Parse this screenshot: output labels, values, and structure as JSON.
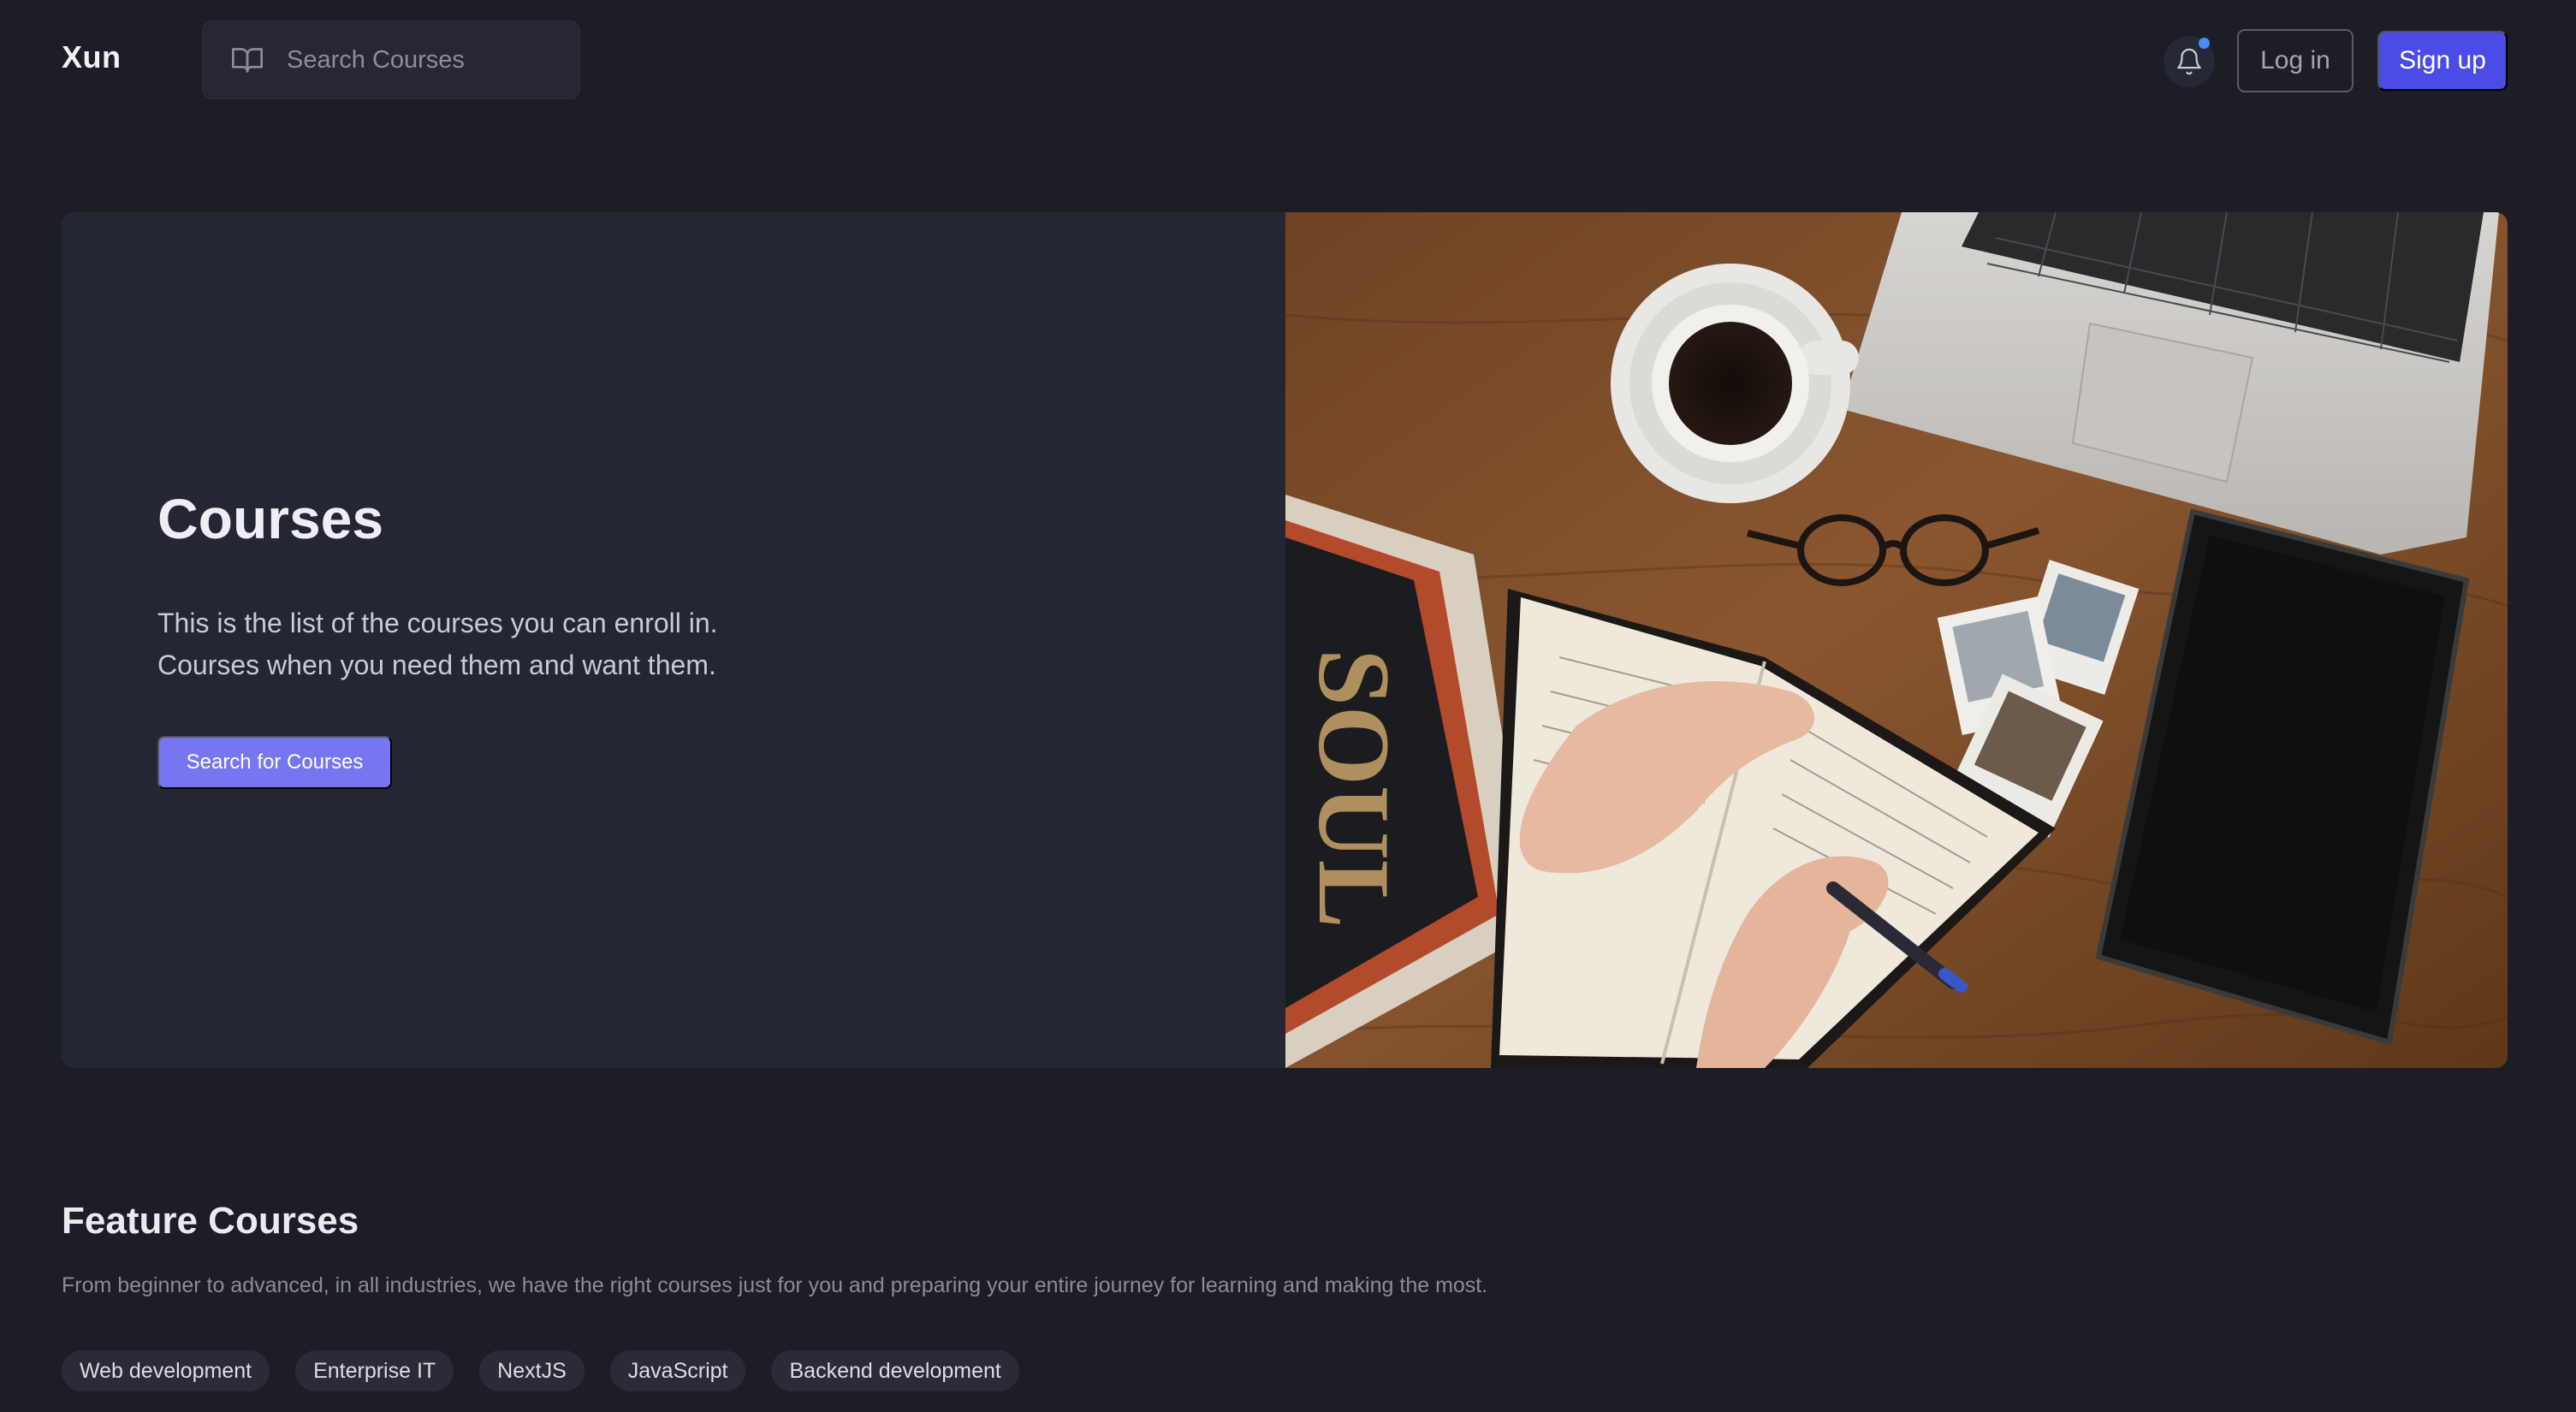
{
  "header": {
    "logo": "Xun",
    "search": {
      "placeholder": "Search Courses",
      "icon": "book-open-icon"
    },
    "notification": {
      "icon": "bell-icon",
      "has_unread": true
    },
    "login_label": "Log in",
    "signup_label": "Sign up"
  },
  "hero": {
    "title": "Courses",
    "description_lines": [
      "This is the list of the courses you can enroll in.",
      "Courses when you need them and want them."
    ],
    "cta_label": "Search for Courses",
    "image_cover_text": "SOUL"
  },
  "featured": {
    "title": "Feature Courses",
    "description": "From beginner to advanced, in all industries, we have the right courses just for you and preparing your entire journey for learning and making the most.",
    "tags": [
      "Web development",
      "Enterprise IT",
      "NextJS",
      "JavaScript",
      "Backend development"
    ]
  },
  "colors": {
    "background": "#1c1d25",
    "surface": "#252633",
    "accent": "#4b4be6",
    "accent_light": "#7676f0",
    "notification_dot": "#4a8cf6"
  }
}
